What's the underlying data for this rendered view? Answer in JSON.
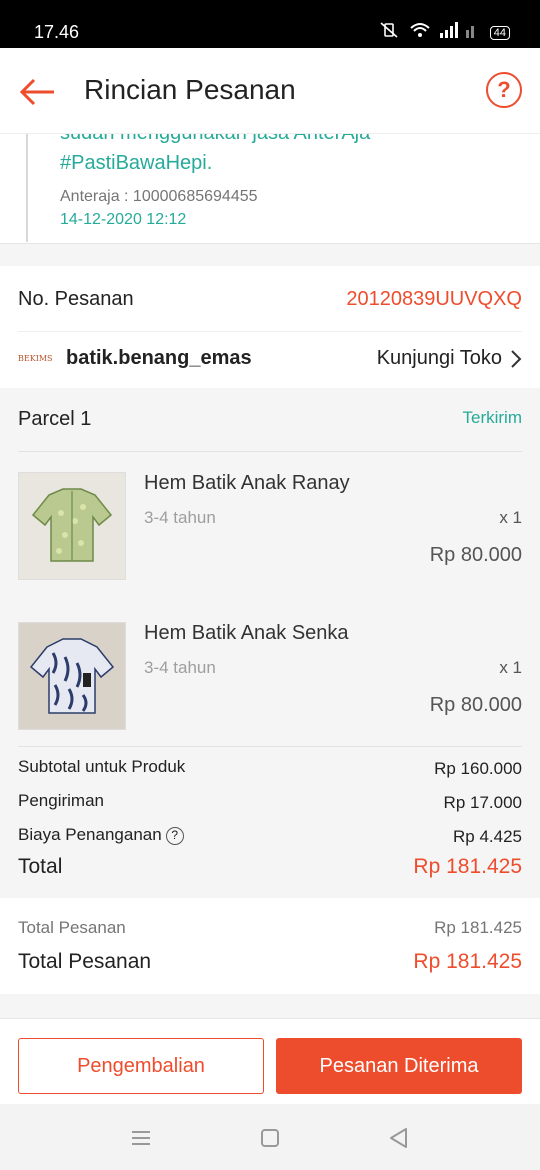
{
  "status_bar": {
    "time": "17.46",
    "battery": "44"
  },
  "header": {
    "title": "Rincian Pesanan",
    "back_icon": "arrow-left-icon",
    "help_icon": "question-circle-icon"
  },
  "tracking": {
    "message_line1": "sudah menggunakan jasa AnterAja",
    "message_line2": "#PastiBawaHepi.",
    "courier_code": "Anteraja :  10000685694455",
    "datetime": "14-12-2020 12:12"
  },
  "order": {
    "number_label": "No. Pesanan",
    "number_value": "20120839UUVQXQ",
    "shop_logo_text": "BEKIMS",
    "shop_name": "batik.benang_emas",
    "visit_label": "Kunjungi Toko"
  },
  "parcel": {
    "label": "Parcel 1",
    "status": "Terkirim",
    "items": [
      {
        "name": "Hem Batik Anak Ranay",
        "variant": "3-4 tahun",
        "qty": "x 1",
        "price": "Rp 80.000"
      },
      {
        "name": "Hem Batik Anak Senka",
        "variant": "3-4 tahun",
        "qty": "x 1",
        "price": "Rp 80.000"
      }
    ],
    "summary": {
      "subtotal_label": "Subtotal untuk Produk",
      "subtotal_value": "Rp 160.000",
      "shipping_label": "Pengiriman",
      "shipping_value": "Rp 17.000",
      "handling_label": "Biaya Penanganan",
      "handling_value": "Rp 4.425",
      "total_label": "Total",
      "total_value": "Rp 181.425"
    }
  },
  "grand_total": {
    "row1_label": "Total Pesanan",
    "row1_value": "Rp 181.425",
    "row2_label": "Total Pesanan",
    "row2_value": "Rp 181.425"
  },
  "actions": {
    "return_label": "Pengembalian",
    "received_label": "Pesanan Diterima"
  },
  "colors": {
    "accent": "#ee4d2d",
    "teal": "#26aa99"
  }
}
